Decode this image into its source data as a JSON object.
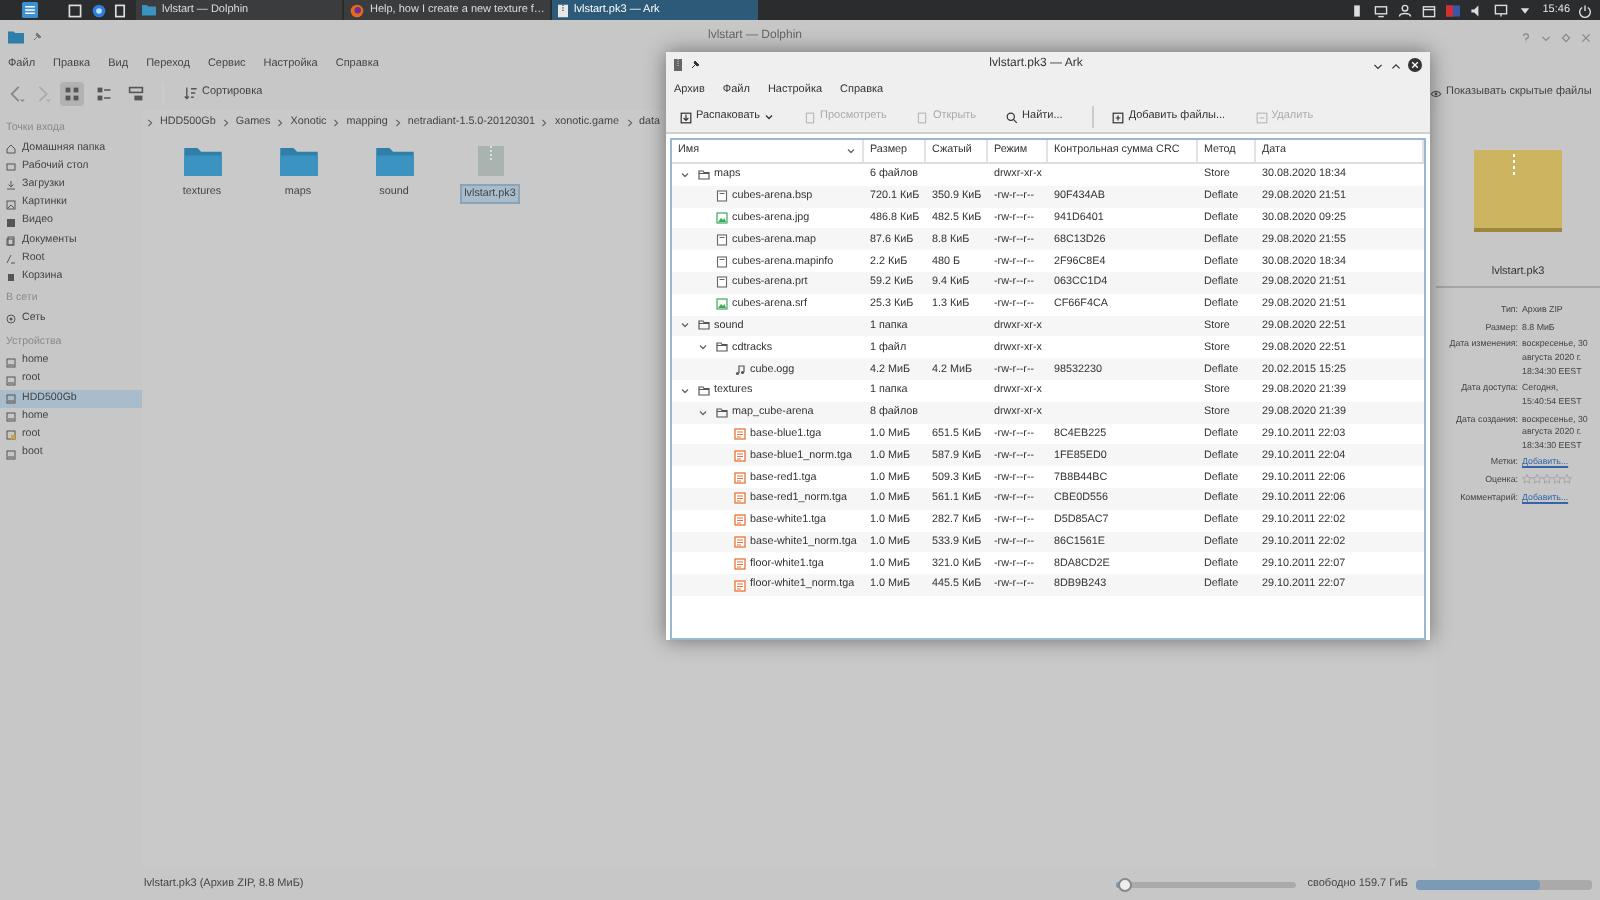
{
  "taskbar": {
    "tasks": [
      {
        "label": "lvlstart — Dolphin",
        "kind": "folder",
        "selected": false
      },
      {
        "label": "Help, how I create a new texture f…",
        "kind": "browser",
        "selected": false
      },
      {
        "label": "lvlstart.pk3 — Ark",
        "kind": "archive",
        "selected": true
      }
    ],
    "clock": "15:46"
  },
  "dolphin": {
    "title": "lvlstart — Dolphin",
    "menu": [
      "Файл",
      "Правка",
      "Вид",
      "Переход",
      "Сервис",
      "Настройка",
      "Справка"
    ],
    "view_buttons": [
      {
        "kind": "icons",
        "selected": true
      },
      {
        "kind": "compact",
        "selected": false
      },
      {
        "kind": "details",
        "selected": false
      }
    ],
    "sort_label": "Сортировка",
    "show_hidden_label": "Показывать скрытые файлы",
    "breadcrumb": [
      "HDD500Gb",
      "Games",
      "Xonotic",
      "mapping",
      "netradiant-1.5.0-20120301",
      "xonotic.game",
      "data"
    ],
    "sidebar": [
      {
        "heading": "Точки входа",
        "items": [
          {
            "label": "Домашняя папка",
            "kind": "home",
            "selected": false
          },
          {
            "label": "Рабочий стол",
            "kind": "desktop",
            "selected": false
          },
          {
            "label": "Загрузки",
            "kind": "download",
            "selected": false
          },
          {
            "label": "Картинки",
            "kind": "picture",
            "selected": false
          },
          {
            "label": "Видео",
            "kind": "video",
            "selected": false
          },
          {
            "label": "Документы",
            "kind": "document",
            "selected": false
          },
          {
            "label": "Root",
            "kind": "root",
            "selected": false
          },
          {
            "label": "Корзина",
            "kind": "trash",
            "selected": false
          }
        ]
      },
      {
        "heading": "В сети",
        "items": [
          {
            "label": "Сеть",
            "kind": "network",
            "selected": false
          }
        ]
      },
      {
        "heading": "Устройства",
        "items": [
          {
            "label": "home",
            "kind": "drive",
            "selected": false
          },
          {
            "label": "root",
            "kind": "drive",
            "selected": false
          },
          {
            "label": "HDD500Gb",
            "kind": "drive",
            "selected": true
          },
          {
            "label": "home",
            "kind": "drive",
            "selected": false
          },
          {
            "label": "root",
            "kind": "locked-drive",
            "selected": false
          },
          {
            "label": "boot",
            "kind": "drive",
            "selected": false
          }
        ]
      }
    ],
    "items": [
      {
        "label": "textures",
        "kind": "folder",
        "selected": false
      },
      {
        "label": "maps",
        "kind": "folder",
        "selected": false
      },
      {
        "label": "sound",
        "kind": "folder",
        "selected": false
      },
      {
        "label": "lvlstart.pk3",
        "kind": "archive",
        "selected": true
      }
    ],
    "info_panel": {
      "filename": "lvlstart.pk3",
      "fields": [
        {
          "label": "Тип:",
          "kind": "text",
          "value": "Архив ZIP"
        },
        {
          "label": "Размер:",
          "kind": "text",
          "value": "8.8 МиБ"
        },
        {
          "label": "Дата изменения:",
          "kind": "text",
          "value": "воскресенье, 30 августа 2020 г. 18:34:30 EEST"
        },
        {
          "label": "Дата доступа:",
          "kind": "text",
          "value": "Сегодня, 15:40:54 EEST"
        },
        {
          "label": "Дата создания:",
          "kind": "text",
          "value": "воскресенье, 30 августа 2020 г. 18:34:30 EEST"
        },
        {
          "label": "Метки:",
          "kind": "link",
          "value": "Добавить..."
        },
        {
          "label": "Оценка:",
          "kind": "rating",
          "stars": 0
        },
        {
          "label": "Комментарий:",
          "kind": "link",
          "value": "Добавить..."
        }
      ]
    },
    "status_bar": {
      "text": "lvlstart.pk3 (Архив ZIP, 8.8 МиБ)",
      "zoom_slider": {
        "level": 0.05
      },
      "free_space": "свободно 159.7 ГиБ",
      "free_space_bar": {
        "level": 0.7
      }
    }
  },
  "ark": {
    "title": "lvlstart.pk3 — Ark",
    "menu": [
      "Архив",
      "Файл",
      "Настройка",
      "Справка"
    ],
    "toolbar": [
      {
        "label": "Распаковать",
        "kind": "extract",
        "disabled": false,
        "dropdown": true
      },
      {
        "label": "Просмотреть",
        "kind": "preview",
        "disabled": true,
        "dropdown": false
      },
      {
        "label": "Открыть",
        "kind": "open",
        "disabled": true,
        "dropdown": false
      },
      {
        "label": "Найти...",
        "kind": "find",
        "disabled": false,
        "dropdown": false
      },
      {
        "label": "Добавить файлы...",
        "kind": "add",
        "disabled": false,
        "dropdown": false
      },
      {
        "label": "Удалить",
        "kind": "delete",
        "disabled": true,
        "dropdown": false
      }
    ],
    "columns": [
      "Имя",
      "Размер",
      "Сжатый",
      "Режим",
      "Контрольная сумма CRC",
      "Метод",
      "Дата"
    ],
    "rows": [
      {
        "name": "maps",
        "kind": "folder",
        "size": "6 файлов",
        "mode": "drwxr-xr-x",
        "method": "Store",
        "date": "30.08.2020 18:34",
        "expanded": true,
        "children": [
          {
            "name": "cubes-arena.bsp",
            "kind": "document",
            "size": "720.1 КиБ",
            "compressed": "350.9 КиБ",
            "mode": "-rw-r--r--",
            "crc": "90F434AB",
            "method": "Deflate",
            "date": "29.08.2020 21:51"
          },
          {
            "name": "cubes-arena.jpg",
            "kind": "image",
            "size": "486.8 КиБ",
            "compressed": "482.5 КиБ",
            "mode": "-rw-r--r--",
            "crc": "941D6401",
            "method": "Deflate",
            "date": "30.08.2020 09:25"
          },
          {
            "name": "cubes-arena.map",
            "kind": "document",
            "size": "87.6 КиБ",
            "compressed": "8.8 КиБ",
            "mode": "-rw-r--r--",
            "crc": "68C13D26",
            "method": "Deflate",
            "date": "29.08.2020 21:55"
          },
          {
            "name": "cubes-arena.mapinfo",
            "kind": "document",
            "size": "2.2 КиБ",
            "compressed": "480 Б",
            "mode": "-rw-r--r--",
            "crc": "2F96C8E4",
            "method": "Deflate",
            "date": "30.08.2020 18:34"
          },
          {
            "name": "cubes-arena.prt",
            "kind": "document",
            "size": "59.2 КиБ",
            "compressed": "9.4 КиБ",
            "mode": "-rw-r--r--",
            "crc": "063CC1D4",
            "method": "Deflate",
            "date": "29.08.2020 21:51"
          },
          {
            "name": "cubes-arena.srf",
            "kind": "image",
            "size": "25.3 КиБ",
            "compressed": "1.3 КиБ",
            "mode": "-rw-r--r--",
            "crc": "CF66F4CA",
            "method": "Deflate",
            "date": "29.08.2020 21:51"
          }
        ]
      },
      {
        "name": "sound",
        "kind": "folder",
        "size": "1 папка",
        "mode": "drwxr-xr-x",
        "method": "Store",
        "date": "29.08.2020 22:51",
        "expanded": true,
        "children": [
          {
            "name": "cdtracks",
            "kind": "folder",
            "size": "1 файл",
            "mode": "drwxr-xr-x",
            "method": "Store",
            "date": "29.08.2020 22:51",
            "expanded": true,
            "children": [
              {
                "name": "cube.ogg",
                "kind": "audio",
                "size": "4.2 МиБ",
                "compressed": "4.2 МиБ",
                "mode": "-rw-r--r--",
                "crc": "98532230",
                "method": "Deflate",
                "date": "20.02.2015 15:25"
              }
            ]
          }
        ]
      },
      {
        "name": "textures",
        "kind": "folder",
        "size": "1 папка",
        "mode": "drwxr-xr-x",
        "method": "Store",
        "date": "29.08.2020 21:39",
        "expanded": true,
        "children": [
          {
            "name": "map_cube-arena",
            "kind": "folder",
            "size": "8 файлов",
            "mode": "drwxr-xr-x",
            "method": "Store",
            "date": "29.08.2020 21:39",
            "expanded": true,
            "children": [
              {
                "name": "base-blue1.tga",
                "kind": "texture",
                "size": "1.0 МиБ",
                "compressed": "651.5 КиБ",
                "mode": "-rw-r--r--",
                "crc": "8C4EB225",
                "method": "Deflate",
                "date": "29.10.2011 22:03"
              },
              {
                "name": "base-blue1_norm.tga",
                "kind": "texture",
                "size": "1.0 МиБ",
                "compressed": "587.9 КиБ",
                "mode": "-rw-r--r--",
                "crc": "1FE85ED0",
                "method": "Deflate",
                "date": "29.10.2011 22:04"
              },
              {
                "name": "base-red1.tga",
                "kind": "texture",
                "size": "1.0 МиБ",
                "compressed": "509.3 КиБ",
                "mode": "-rw-r--r--",
                "crc": "7B8B44BC",
                "method": "Deflate",
                "date": "29.10.2011 22:06"
              },
              {
                "name": "base-red1_norm.tga",
                "kind": "texture",
                "size": "1.0 МиБ",
                "compressed": "561.1 КиБ",
                "mode": "-rw-r--r--",
                "crc": "CBE0D556",
                "method": "Deflate",
                "date": "29.10.2011 22:06"
              },
              {
                "name": "base-white1.tga",
                "kind": "texture",
                "size": "1.0 МиБ",
                "compressed": "282.7 КиБ",
                "mode": "-rw-r--r--",
                "crc": "D5D85AC7",
                "method": "Deflate",
                "date": "29.10.2011 22:02"
              },
              {
                "name": "base-white1_norm.tga",
                "kind": "texture",
                "size": "1.0 МиБ",
                "compressed": "533.9 КиБ",
                "mode": "-rw-r--r--",
                "crc": "86C1561E",
                "method": "Deflate",
                "date": "29.10.2011 22:02"
              },
              {
                "name": "floor-white1.tga",
                "kind": "texture",
                "size": "1.0 МиБ",
                "compressed": "321.0 КиБ",
                "mode": "-rw-r--r--",
                "crc": "8DA8CD2E",
                "method": "Deflate",
                "date": "29.10.2011 22:07"
              },
              {
                "name": "floor-white1_norm.tga",
                "kind": "texture",
                "size": "1.0 МиБ",
                "compressed": "445.5 КиБ",
                "mode": "-rw-r--r--",
                "crc": "8DB9B243",
                "method": "Deflate",
                "date": "29.10.2011 22:07"
              }
            ]
          }
        ]
      }
    ]
  }
}
